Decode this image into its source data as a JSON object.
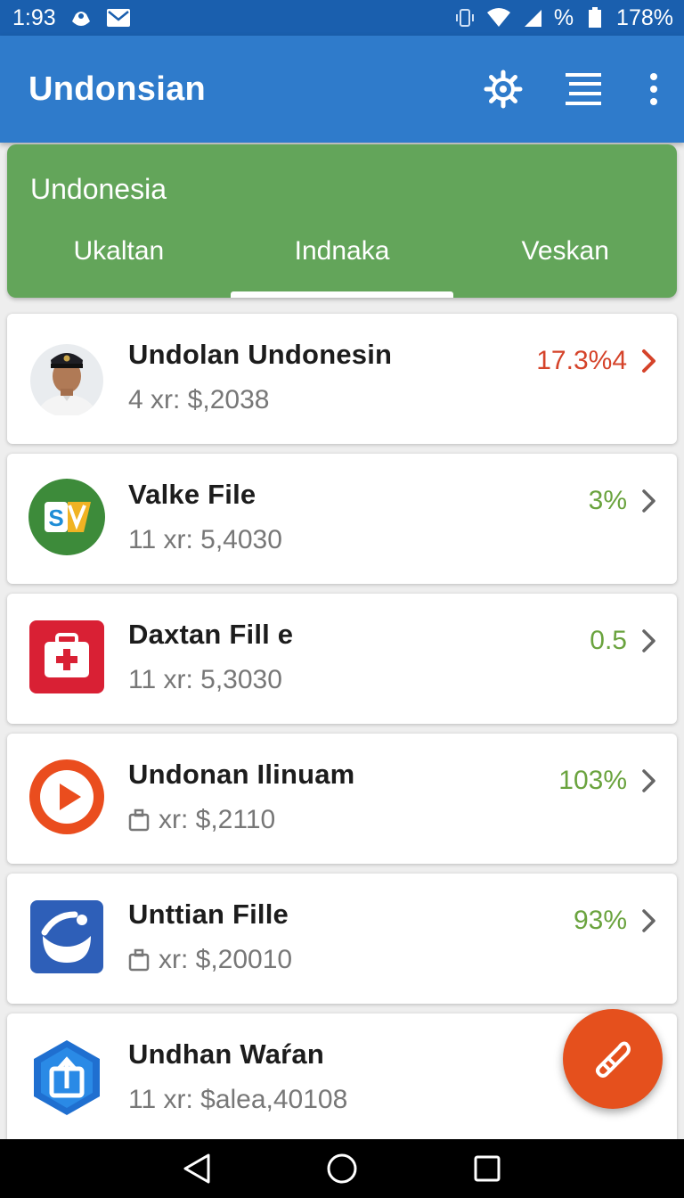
{
  "status_bar": {
    "time": "1:93",
    "battery": "178%",
    "signal_text": "%",
    "icons": [
      "notification-icon",
      "mail-icon",
      "vibrate-icon",
      "wifi-icon",
      "signal-icon",
      "battery-icon"
    ]
  },
  "app_bar": {
    "title": "Undonsian",
    "actions": [
      "settings-icon",
      "list-icon",
      "more-icon"
    ]
  },
  "tab_card": {
    "title": "Undonesia",
    "tabs": [
      {
        "label": "Ukaltan",
        "active": false
      },
      {
        "label": "Indnaka",
        "active": true
      },
      {
        "label": "Veskan",
        "active": false
      }
    ]
  },
  "items": [
    {
      "title": "Undolan Undonesin",
      "subtitle": "4 xr: $,2038",
      "value": "17.3%4",
      "value_color": "#d5432a",
      "chevron_color": "#d5432a",
      "icon": "avatar"
    },
    {
      "title": "Valke File",
      "subtitle": "11 xr: 5,4030",
      "value": "3%",
      "value_color": "#6aa33e",
      "chevron_color": "#666666",
      "icon": "file-sv-icon"
    },
    {
      "title": "Daxtan Fill e",
      "subtitle": "11 xr: 5,3030",
      "value": "0.5",
      "value_color": "#6aa33e",
      "chevron_color": "#666666",
      "icon": "first-aid-icon"
    },
    {
      "title": "Undonan Ilinuam",
      "subtitle": "xr: $,2110",
      "value": "103%",
      "value_color": "#6aa33e",
      "chevron_color": "#666666",
      "icon": "play-icon"
    },
    {
      "title": "Unttian Fille",
      "subtitle": "xr: $,20010",
      "value": "93%",
      "value_color": "#6aa33e",
      "chevron_color": "#666666",
      "icon": "app-logo-icon"
    },
    {
      "title": "Undhan Waŕan",
      "subtitle": "11 xr: $alea,40108",
      "value": "",
      "value_color": "#6aa33e",
      "chevron_color": "#666666",
      "icon": "hexagon-upload-icon"
    }
  ],
  "colors": {
    "status_bar": "#1a5fae",
    "app_bar": "#2f7bcb",
    "tab_card": "#63a55a",
    "fab": "#e5501d"
  },
  "fab": {
    "icon": "tool-icon"
  }
}
